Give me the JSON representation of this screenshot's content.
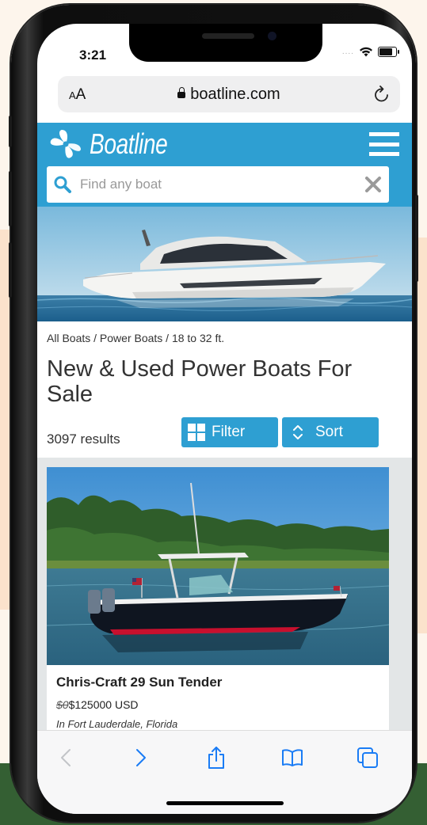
{
  "status": {
    "time": "3:21",
    "signal": "...."
  },
  "browser": {
    "aa_small": "A",
    "aa_large": "A",
    "url": "boatline.com"
  },
  "site": {
    "brand": "Boatline",
    "search_placeholder": "Find any boat"
  },
  "listing": {
    "breadcrumb": "All Boats / Power Boats / 18 to 32 ft.",
    "title": "New & Used Power Boats For Sale",
    "results": "3097 results",
    "filter_label": "Filter",
    "sort_label": "Sort"
  },
  "card": {
    "title": "Chris-Craft 29 Sun Tender",
    "old_price": "$0",
    "price": "$125000 USD",
    "location": "In Fort Lauderdale, Florida"
  },
  "colors": {
    "brand_blue": "#2e9fd2",
    "toolbar_icon": "#1a7cf5"
  },
  "icons": [
    "lock-icon",
    "reload-icon",
    "propeller-logo-icon",
    "hamburger-icon",
    "search-icon",
    "clear-icon",
    "filter-grid-icon",
    "sort-chevrons-icon",
    "back-icon",
    "forward-icon",
    "share-icon",
    "bookmarks-icon",
    "tabs-icon"
  ]
}
